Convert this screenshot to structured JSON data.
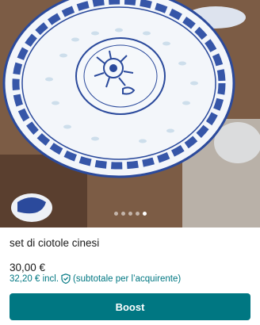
{
  "listing": {
    "title": "set di ciotole cinesi",
    "price": "30,00 €",
    "price_with_fee": "32,20 € incl.",
    "fee_note": "(subtotale per l’acquirente)",
    "photo_count": 5,
    "active_photo_index": 4
  },
  "actions": {
    "boost_label": "Boost"
  },
  "colors": {
    "accent": "#007782",
    "bowl_blue": "#2b4a9c"
  },
  "icons": {
    "fee_icon": "shield-check-icon"
  }
}
